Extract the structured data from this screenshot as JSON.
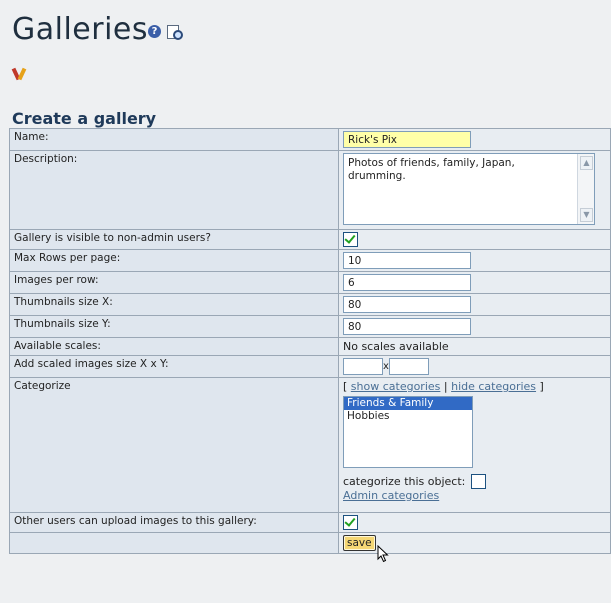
{
  "page": {
    "title": "Galleries",
    "section_title": "Create a gallery"
  },
  "icons": {
    "help": "?",
    "title_icons": [
      "help-icon",
      "magnifier-icon"
    ],
    "toolbar": [
      "tools-icon"
    ]
  },
  "form": {
    "name_label": "Name:",
    "name_value": "Rick's Pix",
    "description_label": "Description:",
    "description_value": "Photos of friends, family, Japan, drumming.",
    "visible_label": "Gallery is visible to non-admin users?",
    "visible_checked": true,
    "max_rows_label": "Max Rows per page:",
    "max_rows_value": "10",
    "images_per_row_label": "Images per row:",
    "images_per_row_value": "6",
    "thumb_x_label": "Thumbnails size X:",
    "thumb_x_value": "80",
    "thumb_y_label": "Thumbnails size Y:",
    "thumb_y_value": "80",
    "scales_label": "Available scales:",
    "scales_value": "No scales available",
    "add_scaled_label": "Add scaled images size X x Y:",
    "x_sep": "x",
    "categorize_label": "Categorize",
    "bracket_open": "[",
    "show_categories": "show categories",
    "link_sep": "|",
    "hide_categories": "hide categories",
    "bracket_close": "]",
    "categories": [
      "Friends & Family",
      "Hobbies"
    ],
    "categories_selected": "Friends & Family",
    "categorize_object_label": "categorize this object:",
    "admin_categories": "Admin categories",
    "upload_label": "Other users can upload images to this gallery:",
    "upload_checked": true,
    "save_label": "save"
  }
}
